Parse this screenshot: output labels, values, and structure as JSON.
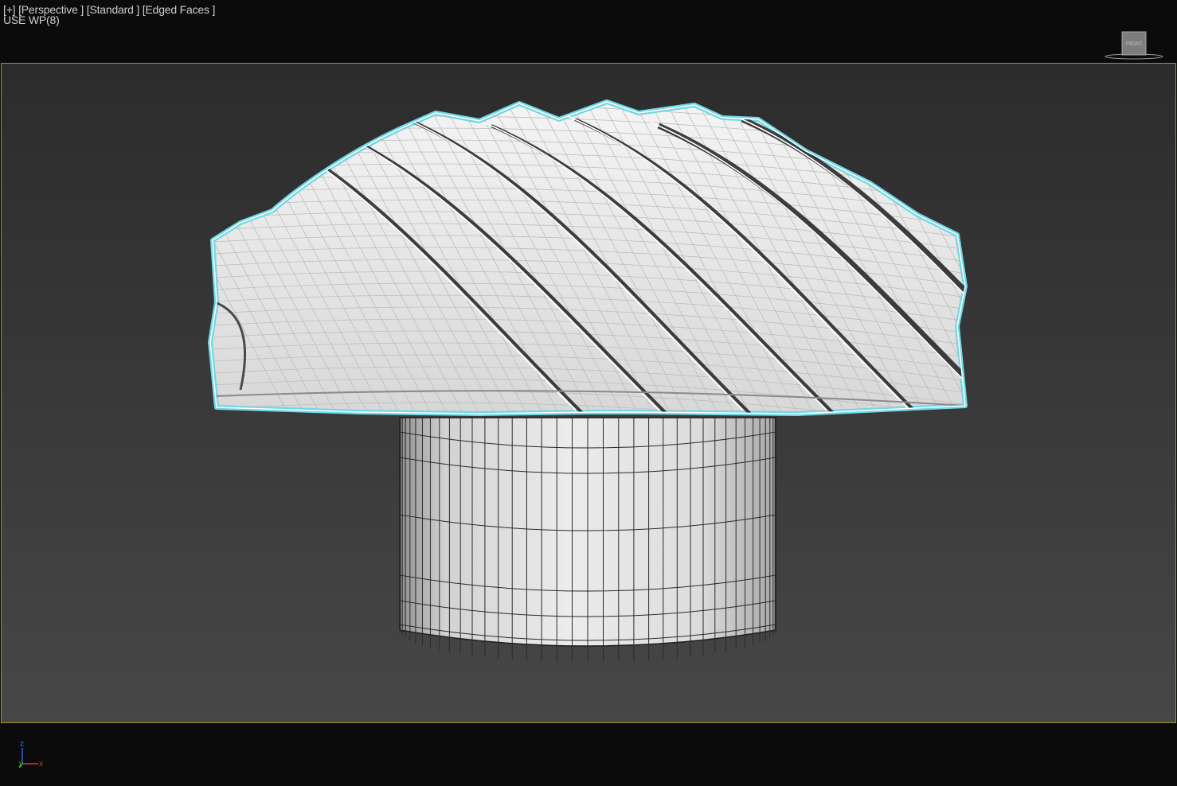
{
  "viewport": {
    "labels": {
      "plus": "[+]",
      "view": "[Perspective ]",
      "shading": "[Standard ]",
      "edged": "[Edged Faces ]"
    },
    "workplane": "USE WP(8)",
    "viewcube": {
      "face": "FRONT"
    },
    "axes": {
      "z": "z",
      "y": "y",
      "x": "x"
    },
    "colors": {
      "selection_outline": "#6fd8e6",
      "viewport_border": "#9a9424",
      "background_top": "#2c2c2c",
      "background_bottom": "#474747",
      "model_fill": "#e6e6e6",
      "wire": "#ffffff",
      "base_wire": "#2a2a2a"
    },
    "model": {
      "fins": 9,
      "base_columns": 38,
      "base_rows": 6
    }
  }
}
